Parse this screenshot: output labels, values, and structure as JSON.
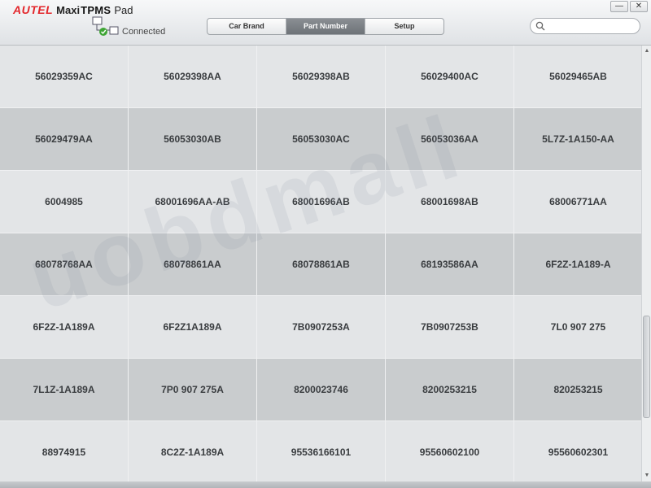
{
  "app": {
    "brand": "AUTEL",
    "product_prefix": "Maxi",
    "product_main": "TPMS",
    "product_suffix": "Pad"
  },
  "connection": {
    "status_label": "Connected",
    "icon": "usb-connected-icon"
  },
  "tabs": [
    {
      "label": "Car Brand",
      "active": false
    },
    {
      "label": "Part Number",
      "active": true
    },
    {
      "label": "Setup",
      "active": false
    }
  ],
  "search": {
    "value": "",
    "placeholder": "",
    "icon": "search-icon"
  },
  "window_controls": {
    "minimize": "—",
    "close": "✕"
  },
  "watermark": "uobdmall",
  "part_numbers": [
    [
      "56029359AC",
      "56029398AA",
      "56029398AB",
      "56029400AC",
      "56029465AB"
    ],
    [
      "56029479AA",
      "56053030AB",
      "56053030AC",
      "56053036AA",
      "5L7Z-1A150-AA"
    ],
    [
      "6004985",
      "68001696AA-AB",
      "68001696AB",
      "68001698AB",
      "68006771AA"
    ],
    [
      "68078768AA",
      "68078861AA",
      "68078861AB",
      "68193586AA",
      "6F2Z-1A189-A"
    ],
    [
      "6F2Z-1A189A",
      "6F2Z1A189A",
      "7B0907253A",
      "7B0907253B",
      "7L0 907 275"
    ],
    [
      "7L1Z-1A189A",
      "7P0 907 275A",
      "8200023746",
      "8200253215",
      "820253215"
    ],
    [
      "88974915",
      "8C2Z-1A189A",
      "95536166101",
      "95560602100",
      "95560602301"
    ]
  ],
  "colors": {
    "brand_red": "#e3262b",
    "active_tab": "#7a7f84",
    "cell_light": "#e3e5e7",
    "cell_dark": "#c9ccce"
  }
}
